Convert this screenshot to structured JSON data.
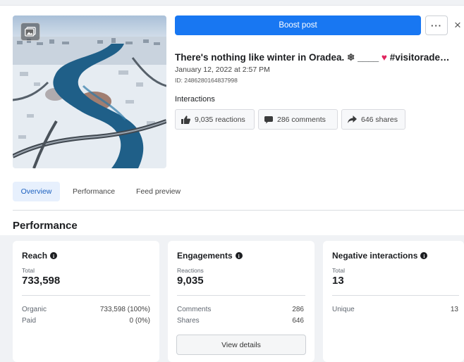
{
  "header": {
    "boost_label": "Boost post",
    "more_label": "···",
    "close_label": "×"
  },
  "post": {
    "title_text": "There's nothing like winter in Oradea.",
    "title_emoji_snow": "❄",
    "title_blank": "____",
    "title_emoji_heart": "♥",
    "title_hashtag": "#visitorade…",
    "date": "January 12, 2022 at 2:57 PM",
    "id": "ID: 2486280164837998",
    "image_icon": "gallery-icon"
  },
  "interactions": {
    "label": "Interactions",
    "reactions": "9,035 reactions",
    "comments": "286 comments",
    "shares": "646 shares"
  },
  "tabs": [
    {
      "label": "Overview",
      "active": true
    },
    {
      "label": "Performance",
      "active": false
    },
    {
      "label": "Feed preview",
      "active": false
    }
  ],
  "performance": {
    "heading": "Performance",
    "reach": {
      "title": "Reach",
      "sub": "Total",
      "value": "733,598",
      "rows": [
        {
          "label": "Organic",
          "value": "733,598 (100%)"
        },
        {
          "label": "Paid",
          "value": "0 (0%)"
        }
      ]
    },
    "engagements": {
      "title": "Engagements",
      "sub": "Reactions",
      "value": "9,035",
      "rows": [
        {
          "label": "Comments",
          "value": "286"
        },
        {
          "label": "Shares",
          "value": "646"
        }
      ],
      "button_label": "View details"
    },
    "negative": {
      "title": "Negative interactions",
      "sub": "Total",
      "value": "13",
      "rows": [
        {
          "label": "Unique",
          "value": "13"
        }
      ]
    }
  },
  "colors": {
    "accent": "#1877f2",
    "tab_active_bg": "#e7f0fd",
    "heart": "#e0245e",
    "panel_bg": "#f0f2f5"
  }
}
